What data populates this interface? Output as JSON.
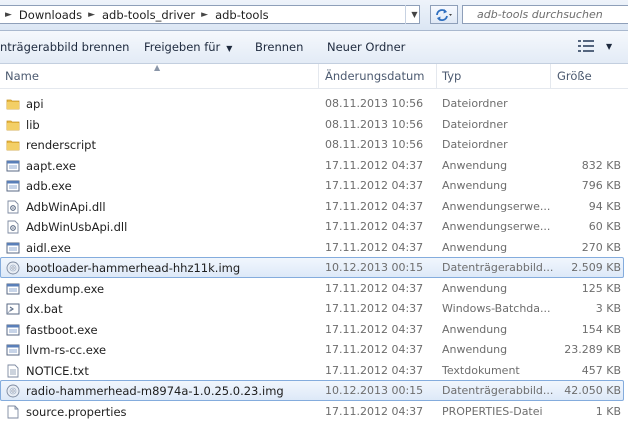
{
  "address": {
    "crumbs": [
      "Downloads",
      "adb-tools_driver",
      "adb-tools"
    ],
    "search_placeholder": "adb-tools durchsuchen"
  },
  "toolbar": {
    "burn_image_label": "nträgerabbild brennen",
    "share_label": "Freigeben für",
    "burn_label": "Brennen",
    "new_folder_label": "Neuer Ordner"
  },
  "columns": {
    "name": "Name",
    "date": "Änderungsdatum",
    "type": "Typ",
    "size": "Größe"
  },
  "files": [
    {
      "name": "api",
      "date": "08.11.2013 10:56",
      "type": "Dateiordner",
      "size": "",
      "icon": "folder-icon",
      "selected": false
    },
    {
      "name": "lib",
      "date": "08.11.2013 10:56",
      "type": "Dateiordner",
      "size": "",
      "icon": "folder-icon",
      "selected": false
    },
    {
      "name": "renderscript",
      "date": "08.11.2013 10:56",
      "type": "Dateiordner",
      "size": "",
      "icon": "folder-icon",
      "selected": false
    },
    {
      "name": "aapt.exe",
      "date": "17.11.2012 04:37",
      "type": "Anwendung",
      "size": "832 KB",
      "icon": "exe-icon",
      "selected": false
    },
    {
      "name": "adb.exe",
      "date": "17.11.2012 04:37",
      "type": "Anwendung",
      "size": "796 KB",
      "icon": "exe-icon",
      "selected": false
    },
    {
      "name": "AdbWinApi.dll",
      "date": "17.11.2012 04:37",
      "type": "Anwendungserwe...",
      "size": "94 KB",
      "icon": "dll-icon",
      "selected": false
    },
    {
      "name": "AdbWinUsbApi.dll",
      "date": "17.11.2012 04:37",
      "type": "Anwendungserwe...",
      "size": "60 KB",
      "icon": "dll-icon",
      "selected": false
    },
    {
      "name": "aidl.exe",
      "date": "17.11.2012 04:37",
      "type": "Anwendung",
      "size": "270 KB",
      "icon": "exe-icon",
      "selected": false
    },
    {
      "name": "bootloader-hammerhead-hhz11k.img",
      "date": "10.12.2013 00:15",
      "type": "Datenträgerabbild...",
      "size": "2.509 KB",
      "icon": "disc-image-icon",
      "selected": true
    },
    {
      "name": "dexdump.exe",
      "date": "17.11.2012 04:37",
      "type": "Anwendung",
      "size": "125 KB",
      "icon": "exe-icon",
      "selected": false
    },
    {
      "name": "dx.bat",
      "date": "17.11.2012 04:37",
      "type": "Windows-Batchda...",
      "size": "3 KB",
      "icon": "bat-icon",
      "selected": false
    },
    {
      "name": "fastboot.exe",
      "date": "17.11.2012 04:37",
      "type": "Anwendung",
      "size": "154 KB",
      "icon": "exe-icon",
      "selected": false
    },
    {
      "name": "llvm-rs-cc.exe",
      "date": "17.11.2012 04:37",
      "type": "Anwendung",
      "size": "23.289 KB",
      "icon": "exe-icon",
      "selected": false
    },
    {
      "name": "NOTICE.txt",
      "date": "17.11.2012 04:37",
      "type": "Textdokument",
      "size": "457 KB",
      "icon": "text-file-icon",
      "selected": false
    },
    {
      "name": "radio-hammerhead-m8974a-1.0.25.0.23.img",
      "date": "10.12.2013 00:15",
      "type": "Datenträgerabbild...",
      "size": "42.050 KB",
      "icon": "disc-image-icon",
      "selected": true
    },
    {
      "name": "source.properties",
      "date": "17.11.2012 04:37",
      "type": "PROPERTIES-Datei",
      "size": "1 KB",
      "icon": "generic-file-icon",
      "selected": false
    }
  ],
  "colors": {
    "selection_border": "#84acdd",
    "folder": "#e8b840",
    "secondary_text": "#6d6d6d"
  }
}
